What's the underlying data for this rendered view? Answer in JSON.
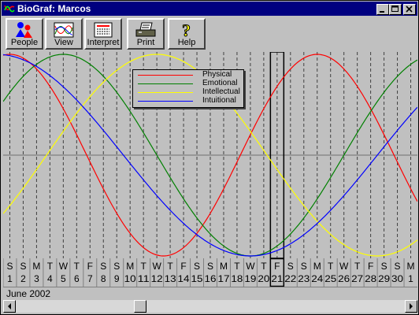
{
  "window": {
    "title": "BioGraf: Marcos"
  },
  "toolbar": {
    "buttons": [
      {
        "label": "People",
        "icon": "people-icon"
      },
      {
        "label": "View",
        "icon": "view-icon"
      },
      {
        "label": "Interpret",
        "icon": "interpret-icon"
      },
      {
        "label": "Print",
        "icon": "print-icon"
      },
      {
        "label": "Help",
        "icon": "help-icon"
      }
    ]
  },
  "legend": {
    "items": [
      {
        "name": "Physical",
        "color": "#ff0000"
      },
      {
        "name": "Emotional",
        "color": "#008000"
      },
      {
        "name": "Intellectual",
        "color": "#ffff00"
      },
      {
        "name": "Intuitional",
        "color": "#0000ff"
      }
    ]
  },
  "calendar": {
    "month": "June 2002",
    "weekday_letters": [
      "S",
      "S",
      "M",
      "T",
      "W",
      "T",
      "F",
      "S",
      "S",
      "M",
      "T",
      "W",
      "T",
      "F",
      "S",
      "S",
      "M",
      "T",
      "W",
      "T",
      "F",
      "S",
      "S",
      "M",
      "T",
      "W",
      "T",
      "F",
      "S",
      "S",
      "M"
    ],
    "dates": [
      "1",
      "2",
      "3",
      "4",
      "5",
      "6",
      "7",
      "8",
      "9",
      "10",
      "11",
      "12",
      "13",
      "14",
      "15",
      "16",
      "17",
      "18",
      "19",
      "20",
      "21",
      "22",
      "23",
      "24",
      "25",
      "26",
      "27",
      "28",
      "29",
      "30",
      "1"
    ],
    "today": "21"
  },
  "chart_data": {
    "type": "line",
    "x_start_day": 1,
    "x_end_day": 31,
    "y_range": [
      -1,
      1
    ],
    "series": [
      {
        "name": "Physical",
        "period_days": 23,
        "peak_day": 24,
        "color": "#ff0000"
      },
      {
        "name": "Emotional",
        "period_days": 28,
        "peak_day": 5,
        "color": "#008000"
      },
      {
        "name": "Intellectual",
        "period_days": 33,
        "peak_day": 12,
        "color": "#ffff00"
      },
      {
        "name": "Intuitional",
        "period_days": 38,
        "peak_day": 0,
        "color": "#0000ff"
      }
    ],
    "highlight_day": 21
  },
  "icons": {
    "app": "app-icon",
    "minimize": "minimize-icon",
    "maximize": "maximize-icon",
    "close": "close-icon",
    "scroll_left": "arrow-left-icon",
    "scroll_right": "arrow-right-icon"
  }
}
